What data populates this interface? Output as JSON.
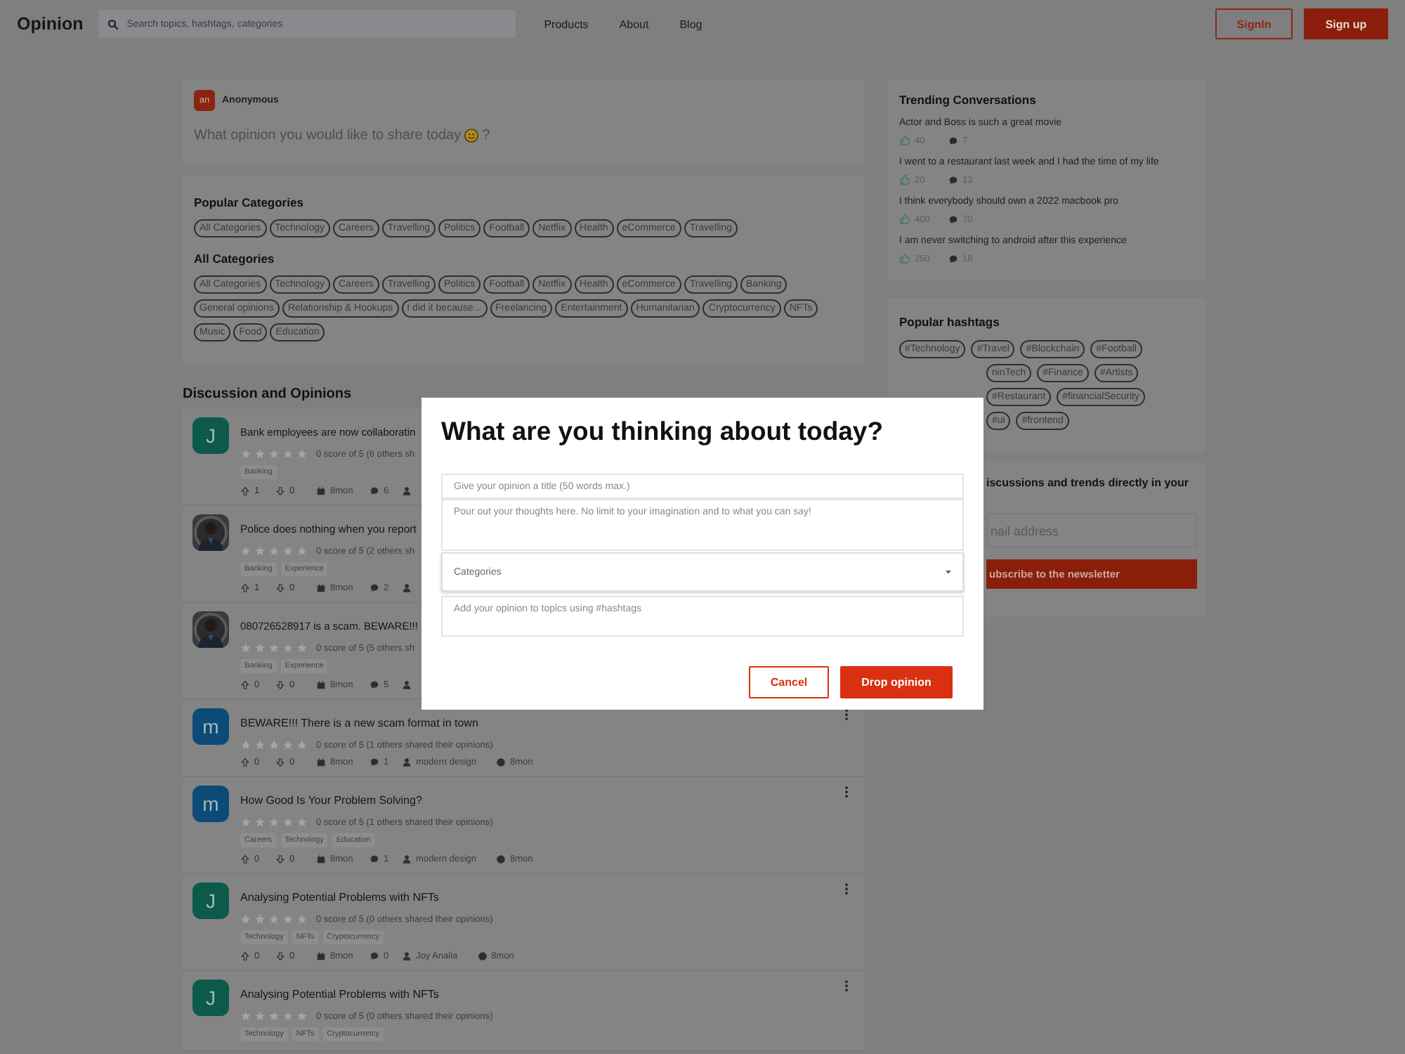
{
  "header": {
    "logo": "Opinion",
    "search": {
      "placeholder": "Search topics, hashtags, categories"
    },
    "nav": [
      "Products",
      "About",
      "Blog"
    ],
    "signin": "SignIn",
    "signup": "Sign up"
  },
  "composer": {
    "avatar": "an",
    "author": "Anonymous",
    "prompt": "What opinion you would like to share today",
    "prompt_end": "?"
  },
  "categories": {
    "popular_title": "Popular Categories",
    "popular": [
      "All Categories",
      "Technology",
      "Careers",
      "Travelling",
      "Politics",
      "Football",
      "Netflix",
      "Health",
      "eCommerce",
      "Travelling"
    ],
    "all_title": "All Categories",
    "all": [
      "All Categories",
      "Technology",
      "Careers",
      "Travelling",
      "Politics",
      "Football",
      "Netflix",
      "Health",
      "eCommerce",
      "Travelling",
      "Banking",
      "General opinions",
      "Relationship & Hookups",
      "I did it because...",
      "Freelancing",
      "Entertainment",
      "Humanitarian",
      "Cryptocurrency",
      "NFTs",
      "Music",
      "Food",
      "Education"
    ]
  },
  "discussion_title": "Discussion and Opinions",
  "posts": [
    {
      "avatar": {
        "kind": "letter",
        "letter": "J",
        "color": "#0d5a4b"
      },
      "title": "Bank employees are now collaboratin",
      "stars": 0,
      "score": "0 score of 5 (6 others sh",
      "tags": [
        "Banking"
      ],
      "actions": {
        "upvotes": "1",
        "downvotes": "0",
        "date": "8mon",
        "comments": "6"
      }
    },
    {
      "avatar": {
        "kind": "picture"
      },
      "title": "Police does nothing when you report",
      "stars": 0,
      "score": "0 score of 5 (2 others sh",
      "tags": [
        "Banking",
        "Experience"
      ],
      "actions": {
        "upvotes": "1",
        "downvotes": "0",
        "date": "8mon",
        "comments": "2"
      }
    },
    {
      "avatar": {
        "kind": "picture"
      },
      "title": "080726528917 is a scam. BEWARE!!!",
      "stars": 0,
      "score": "0 score of 5 (5 others sh",
      "tags": [
        "Banking",
        "Experience"
      ],
      "actions": {
        "upvotes": "0",
        "downvotes": "0",
        "date": "8mon",
        "comments": "5"
      }
    },
    {
      "avatar": {
        "kind": "letter",
        "letter": "m",
        "color": "#0c4a78"
      },
      "title": "BEWARE!!! There is a new scam format in town",
      "stars": 0,
      "score": "0 score of 5 (1 others shared their opinions)",
      "actions": {
        "upvotes": "0",
        "downvotes": "0",
        "date": "8mon",
        "comments": "1",
        "author": "modern design",
        "time": "8mon"
      }
    },
    {
      "avatar": {
        "kind": "letter",
        "letter": "m",
        "color": "#0c4a78"
      },
      "title": "How Good Is Your Problem Solving?",
      "stars": 0,
      "score": "0 score of 5 (1 others shared their opinions)",
      "tags": [
        "Careers",
        "Technology",
        "Education"
      ],
      "actions": {
        "upvotes": "0",
        "downvotes": "0",
        "date": "8mon",
        "comments": "1",
        "author": "modern design",
        "time": "8mon"
      }
    },
    {
      "avatar": {
        "kind": "letter",
        "letter": "J",
        "color": "#0d5a4b"
      },
      "title": "Analysing Potential Problems with NFTs",
      "stars": 0,
      "score": "0 score of 5 (0 others shared their opinions)",
      "tags": [
        "Technology",
        "NFTs",
        "Cryptocurrency"
      ],
      "actions": {
        "upvotes": "0",
        "downvotes": "0",
        "date": "8mon",
        "comments": "0",
        "author": "Joy Analia",
        "time": "8mon"
      }
    },
    {
      "avatar": {
        "kind": "letter",
        "letter": "J",
        "color": "#0d5a4b"
      },
      "title": "Analysing Potential Problems with NFTs",
      "stars": 0,
      "score": "0 score of 5 (0 others shared their opinions)",
      "tags": [
        "Technology",
        "NFTs",
        "Cryptocurrency"
      ]
    }
  ],
  "trending": {
    "title": "Trending Conversations",
    "items": [
      {
        "text": "Actor and Boss is such a great movie",
        "likes": "40",
        "comments": "7"
      },
      {
        "text": "I went to a restaurant last week and I had the time of my life",
        "likes": "20",
        "comments": "13"
      },
      {
        "text": "I think everybody should own a 2022 macbook pro",
        "likes": "400",
        "comments": "70"
      },
      {
        "text": "I am never switching to android after this experience",
        "likes": "250",
        "comments": "18"
      }
    ]
  },
  "hashtags": {
    "title": "Popular hashtags",
    "tags": [
      "#Technology",
      "#Travel",
      "#Blockchain",
      "#Football",
      "ninTech",
      "#Finance",
      "#Artists",
      "#Restaurant",
      "#financialSecurity",
      "#ui",
      "#frontend"
    ]
  },
  "newsletter": {
    "heading": "iscussions and trends directly in your",
    "email": {
      "placeholder": "nail address"
    },
    "button": "ubscribe to the newsletter"
  },
  "modal": {
    "title": "What are you thinking about today?",
    "title_field": {
      "placeholder": "Give your opinion a title (50 words max.)"
    },
    "body_field": {
      "placeholder": "Pour out your thoughts here. No limit to your imagination and to what you can say!"
    },
    "category_select": {
      "placeholder": "Categories"
    },
    "hashtags_field": {
      "placeholder": "Add your opinion to topics using #hashtags"
    },
    "cancel": "Cancel",
    "submit": "Drop opinion"
  }
}
